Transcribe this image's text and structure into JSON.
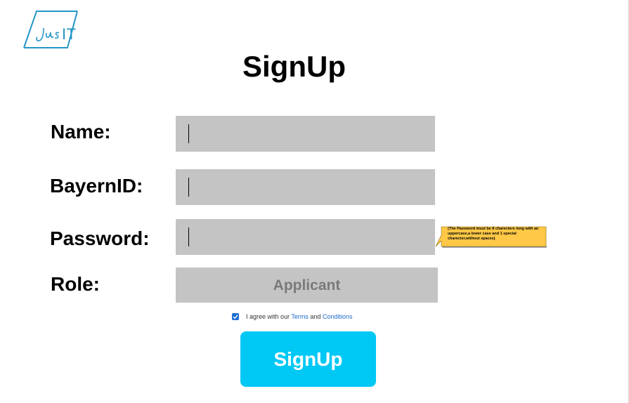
{
  "brand": {
    "logo_text": "IT",
    "logo_script": "Jus"
  },
  "title": "SignUp",
  "form": {
    "name_label": "Name:",
    "name_value": "",
    "bayernid_label": "BayernID:",
    "bayernid_value": "",
    "password_label": "Password:",
    "password_value": "",
    "password_hint": "(The Password must be 8 charecters long with an uppercase,a lower case and 1 special charecter,without spaces)",
    "role_label": "Role:",
    "role_value": "Applicant"
  },
  "agreement": {
    "checked": true,
    "prefix": "I agree with our",
    "terms_link": "Terms",
    "conjunction": "and",
    "conditions_link": "Conditions"
  },
  "submit_label": "SignUp",
  "colors": {
    "field_bg": "#c4c4c4",
    "button_bg": "#00c8f5",
    "tooltip_bg": "#ffc846",
    "link": "#1b6ac9",
    "logo": "#2596c8"
  }
}
